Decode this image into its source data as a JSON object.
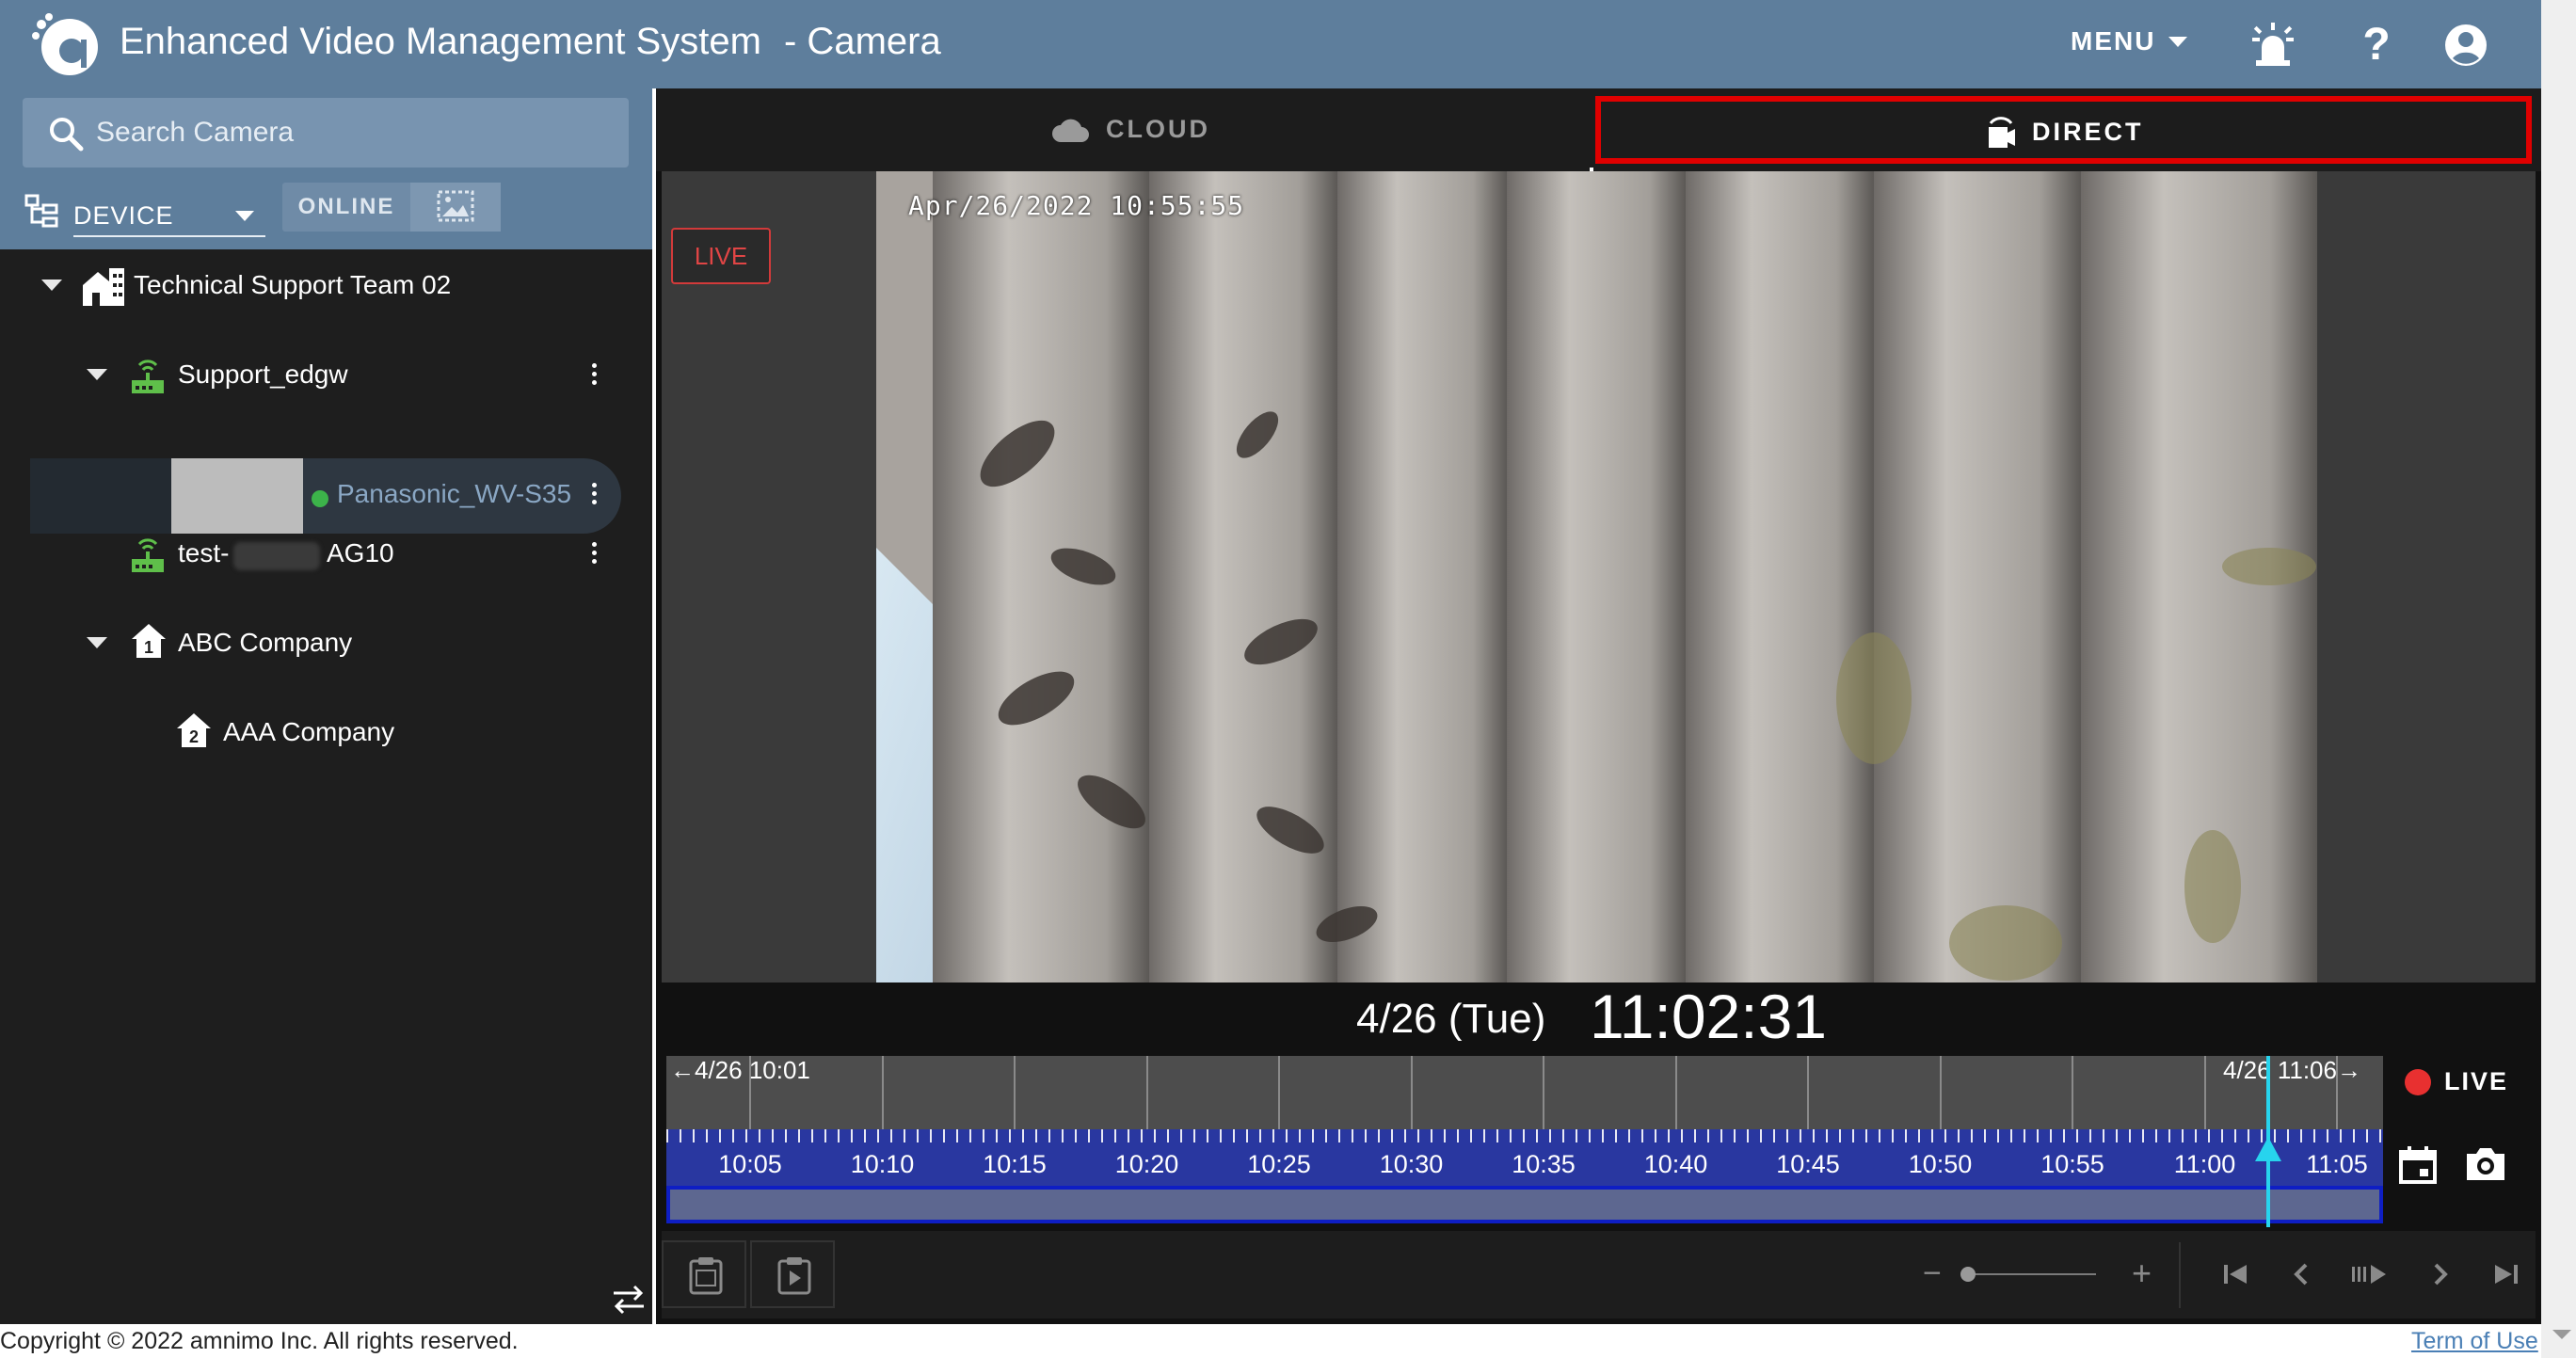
{
  "header": {
    "app_title": "Enhanced Video Management System",
    "page_suffix": "- Camera",
    "menu_label": "MENU",
    "help_glyph": "?",
    "icons": [
      "app-logo-icon",
      "alarm-light-icon",
      "help-icon",
      "account-icon"
    ]
  },
  "sidebar": {
    "search_placeholder": "Search Camera",
    "device_select_value": "DEVICE",
    "online_label": "ONLINE",
    "tree": [
      {
        "label": "Technical Support Team 02",
        "icon": "building-icon",
        "expanded": true
      },
      {
        "label": "Support_edgw",
        "icon": "gateway-icon",
        "expanded": true
      },
      {
        "label": "Panasonic_WV-S35",
        "icon": "camera-thumbnail",
        "status": "online",
        "selected": true
      },
      {
        "label_prefix": "test-",
        "label_suffix": "AG10",
        "icon": "gateway-icon"
      },
      {
        "label": "ABC Company",
        "icon": "home-1-icon",
        "expanded": true
      },
      {
        "label": "AAA Company",
        "icon": "home-2-icon"
      }
    ]
  },
  "tabs": {
    "cloud_label": "CLOUD",
    "direct_label": "DIRECT",
    "active": "DIRECT"
  },
  "player": {
    "live_badge": "LIVE",
    "overlay_timestamp": "Apr/26/2022  10:55:55",
    "date_label": "4/26 (Tue)",
    "time_label": "11:02:31"
  },
  "timeline": {
    "range_start_label": "4/26 10:01",
    "range_end_label": "4/26 11:06",
    "tick_labels": [
      "10:05",
      "10:10",
      "10:15",
      "10:20",
      "10:25",
      "10:30",
      "10:35",
      "10:40",
      "10:45",
      "10:50",
      "10:55",
      "11:00",
      "11:05"
    ],
    "cursor_time": "11:02"
  },
  "live_control": {
    "label": "LIVE"
  },
  "footer": {
    "copyright": "Copyright © 2022 amnimo Inc. All rights reserved.",
    "term_link": "Term of Use"
  },
  "colors": {
    "header_bg": "#5e7e9c",
    "sidebar_bg": "#1e1e1e",
    "active_tab_border": "#e00000",
    "timeline_band": "#2937a0",
    "cursor": "#27d4ee",
    "online_dot": "#3cb34a",
    "live_red": "#e83030"
  }
}
